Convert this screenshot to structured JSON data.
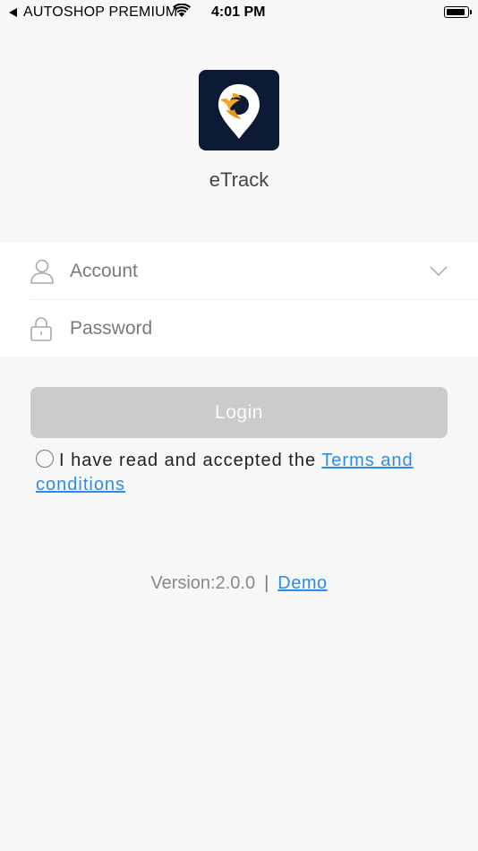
{
  "status_bar": {
    "carrier": "AUTOSHOP PREMIUM",
    "time": "4:01 PM",
    "battery_level": 0.95
  },
  "app": {
    "name": "eTrack",
    "logo_colors": {
      "background": "#0c1a36",
      "pin": "#ffffff",
      "bird": "#f5a623"
    }
  },
  "form": {
    "account": {
      "placeholder": "Account",
      "value": "",
      "icon": "user-icon",
      "dropdown_icon": "chevron-down-icon"
    },
    "password": {
      "placeholder": "Password",
      "value": "",
      "icon": "lock-icon"
    }
  },
  "login": {
    "label": "Login"
  },
  "terms": {
    "text": "I have read and accepted the ",
    "link": "Terms and conditions",
    "checked": false
  },
  "footer": {
    "version": "Version:2.0.0",
    "separator": "|",
    "demo": "Demo"
  },
  "colors": {
    "accent": "#2d8ce8",
    "button_disabled": "#cbcbcb",
    "background": "#f7f7f7"
  }
}
